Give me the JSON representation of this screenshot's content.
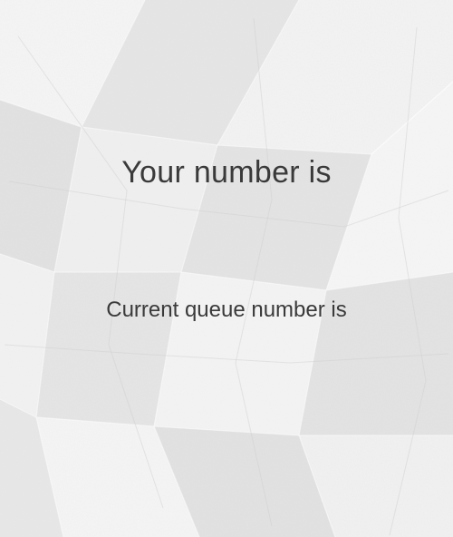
{
  "ticket": {
    "label": "Your number is",
    "value": ""
  },
  "queue": {
    "label": "Current queue number is",
    "value": ""
  }
}
